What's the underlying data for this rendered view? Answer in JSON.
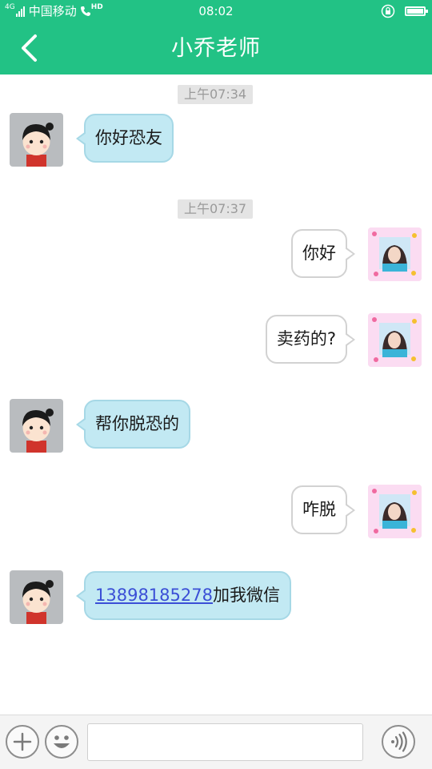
{
  "status_bar": {
    "network": "4G",
    "carrier": "中国移动",
    "hd": "HD",
    "time": "08:02"
  },
  "header": {
    "title": "小乔老师",
    "back_icon": "chevron-left-icon"
  },
  "messages": [
    {
      "kind": "timestamp",
      "text": "上午07:34"
    },
    {
      "kind": "message",
      "side": "left",
      "text": "你好恐友"
    },
    {
      "kind": "timestamp",
      "text": "上午07:37"
    },
    {
      "kind": "message",
      "side": "right",
      "text": "你好"
    },
    {
      "kind": "message",
      "side": "right",
      "text": "卖药的?"
    },
    {
      "kind": "message",
      "side": "left",
      "text": "帮你脱恐的"
    },
    {
      "kind": "message",
      "side": "right",
      "text": "咋脱"
    },
    {
      "kind": "message",
      "side": "left",
      "link": "13898185278",
      "text": "加我微信"
    }
  ],
  "input_bar": {
    "add_icon": "plus-icon",
    "emoji_icon": "smiley-icon",
    "message_value": "",
    "voice_icon": "voice-wave-icon"
  },
  "colors": {
    "brand_green": "#22c285",
    "incoming_bubble": "#c2e9f3",
    "outgoing_bubble": "#ffffff",
    "link_blue": "#3b4fd6"
  }
}
